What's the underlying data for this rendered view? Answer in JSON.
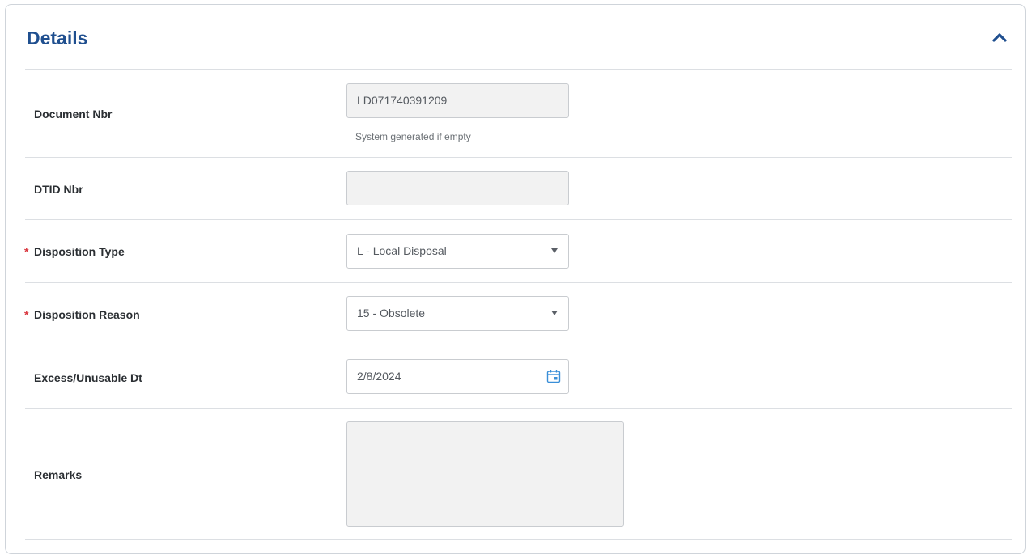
{
  "panel": {
    "title": "Details"
  },
  "fields": {
    "document_nbr": {
      "label": "Document Nbr",
      "value": "LD071740391209",
      "help": "System generated if empty"
    },
    "dtid_nbr": {
      "label": "DTID Nbr",
      "value": ""
    },
    "disposition_type": {
      "label": "Disposition Type",
      "required_marker": "*",
      "value": "L - Local Disposal"
    },
    "disposition_reason": {
      "label": "Disposition Reason",
      "required_marker": "*",
      "value": "15 - Obsolete"
    },
    "excess_dt": {
      "label": "Excess/Unusable Dt",
      "value": "2/8/2024"
    },
    "remarks": {
      "label": "Remarks",
      "value": ""
    }
  },
  "icons": {
    "collapse": "chevron-up-icon",
    "select": "chevron-down-icon",
    "date": "calendar-icon"
  },
  "colors": {
    "title": "#1f4f8f",
    "required": "#d9363e",
    "calendar_accent": "#3a8fd8"
  }
}
